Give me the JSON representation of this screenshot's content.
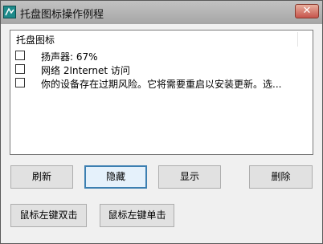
{
  "window": {
    "title": "托盘图标操作例程",
    "close_glyph": "✕"
  },
  "list": {
    "header": "托盘图标",
    "items": [
      {
        "label": "扬声器: 67%",
        "checked": false
      },
      {
        "label": "网络 2Internet 访问",
        "checked": false
      },
      {
        "label": "你的设备存在过期风险。它将需要重启以安装更新。选...",
        "checked": false
      }
    ]
  },
  "buttons": {
    "refresh": "刷新",
    "hide": "隐藏",
    "show": "显示",
    "delete": "删除",
    "left_double": "鼠标左键双击",
    "right_single": "鼠标左键单击"
  }
}
